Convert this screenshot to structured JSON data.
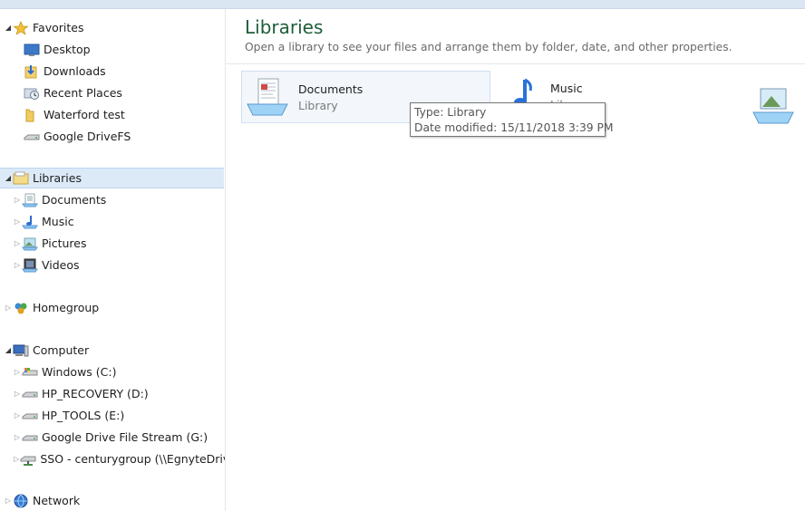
{
  "nav": {
    "favorites": {
      "label": "Favorites",
      "items": [
        {
          "label": "Desktop",
          "icon": "desktop-icon"
        },
        {
          "label": "Downloads",
          "icon": "downloads-folder-icon"
        },
        {
          "label": "Recent Places",
          "icon": "recent-places-icon"
        },
        {
          "label": "Waterford test",
          "icon": "folder-icon"
        },
        {
          "label": "Google DriveFS",
          "icon": "drive-icon"
        }
      ]
    },
    "libraries": {
      "label": "Libraries",
      "items": [
        {
          "label": "Documents",
          "icon": "documents-library-icon"
        },
        {
          "label": "Music",
          "icon": "music-library-icon"
        },
        {
          "label": "Pictures",
          "icon": "pictures-library-icon"
        },
        {
          "label": "Videos",
          "icon": "videos-library-icon"
        }
      ]
    },
    "homegroup": {
      "label": "Homegroup"
    },
    "computer": {
      "label": "Computer",
      "items": [
        {
          "label": "Windows  (C:)",
          "icon": "windows-drive-icon"
        },
        {
          "label": "HP_RECOVERY (D:)",
          "icon": "drive-icon"
        },
        {
          "label": "HP_TOOLS (E:)",
          "icon": "drive-icon"
        },
        {
          "label": "Google Drive File Stream (G:)",
          "icon": "drive-icon"
        },
        {
          "label": "SSO - centurygroup (\\\\EgnyteDrive",
          "icon": "network-drive-icon"
        }
      ]
    },
    "network": {
      "label": "Network"
    }
  },
  "main": {
    "title": "Libraries",
    "subtitle": "Open a library to see your files and arrange them by folder, date, and other properties.",
    "libraries": [
      {
        "name": "Documents",
        "type": "Library"
      },
      {
        "name": "Music",
        "type": "Library"
      }
    ]
  },
  "tooltip": {
    "type_line": "Type: Library",
    "date_line": "Date modified: 15/11/2018 3:39 PM"
  },
  "colors": {
    "title": "#1e5e3a",
    "selected_bg": "#dceaf8",
    "tooltip_border": "#777777"
  }
}
